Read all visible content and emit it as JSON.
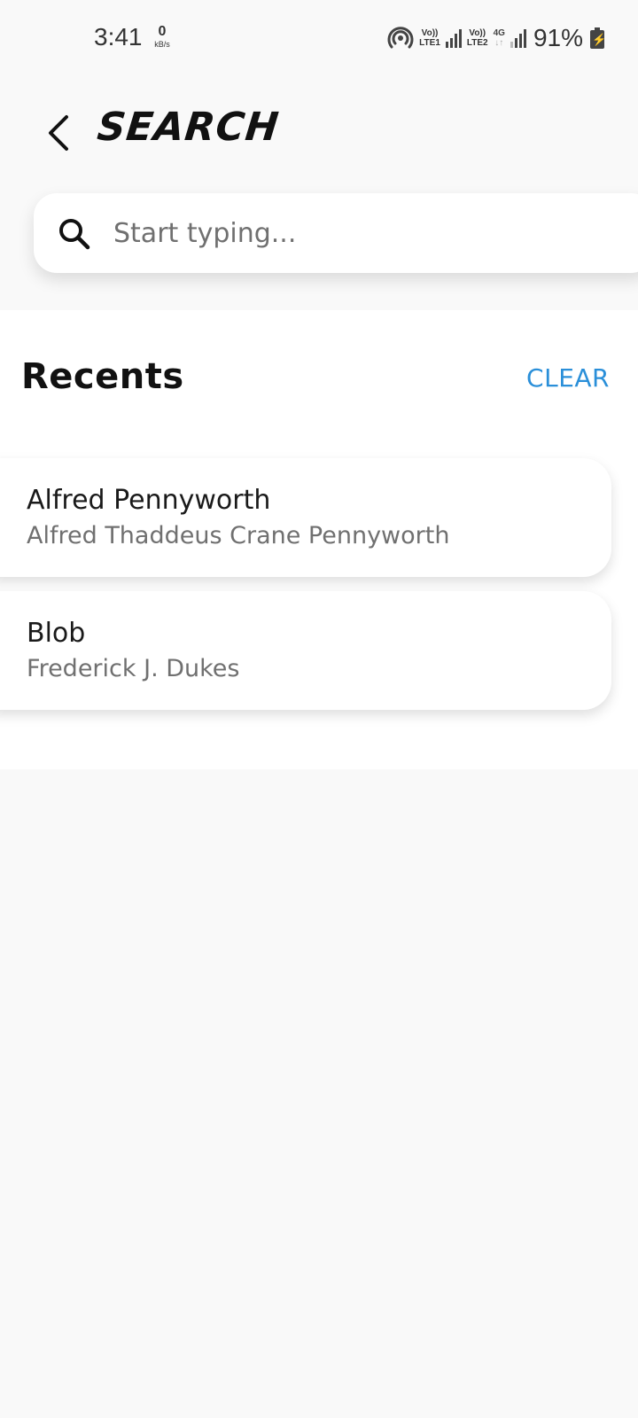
{
  "status_bar": {
    "time": "3:41",
    "net_speed_value": "0",
    "net_speed_unit": "kB/s",
    "volte1_top": "Vo))",
    "volte1_bottom": "LTE1",
    "volte2_top": "Vo))",
    "volte2_bottom": "LTE2",
    "network_type": "4G",
    "battery": "91%"
  },
  "header": {
    "title": "SEARCH"
  },
  "search": {
    "placeholder": "Start typing...",
    "value": ""
  },
  "recents": {
    "title": "Recents",
    "clear_label": "CLEAR",
    "items": [
      {
        "name": "Alfred Pennyworth",
        "full_name": "Alfred Thaddeus Crane Pennyworth"
      },
      {
        "name": "Blob",
        "full_name": "Frederick J. Dukes"
      }
    ]
  },
  "colors": {
    "accent": "#2a8fd9",
    "background": "#f9f9f9",
    "panel": "#ffffff"
  },
  "icons": {
    "back": "arrow-left",
    "search": "magnifier",
    "hotspot": "hotspot",
    "battery": "battery-charging"
  }
}
